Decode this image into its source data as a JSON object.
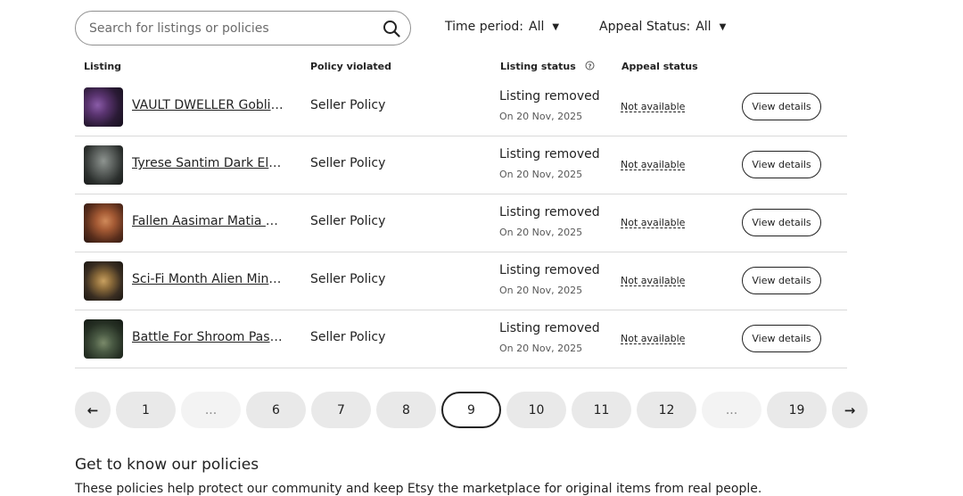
{
  "search": {
    "placeholder": "Search for listings or policies",
    "value": ""
  },
  "filters": {
    "time_period": {
      "label": "Time period:",
      "value": "All"
    },
    "appeal_status": {
      "label": "Appeal Status:",
      "value": "All"
    }
  },
  "columns": {
    "listing": "Listing",
    "policy": "Policy violated",
    "status": "Listing status",
    "appeal": "Appeal status"
  },
  "rows": [
    {
      "title": "VAULT DWELLER Goblin ...",
      "policy": "Seller Policy",
      "status": "Listing removed",
      "date": "On 20 Nov, 2025",
      "appeal": "Not available",
      "action": "View details"
    },
    {
      "title": "Tyrese Santim Dark Elf - ...",
      "policy": "Seller Policy",
      "status": "Listing removed",
      "date": "On 20 Nov, 2025",
      "appeal": "Not available",
      "action": "View details"
    },
    {
      "title": "Fallen Aasimar Matia Ka...",
      "policy": "Seller Policy",
      "status": "Listing removed",
      "date": "On 20 Nov, 2025",
      "appeal": "Not available",
      "action": "View details"
    },
    {
      "title": "Sci-Fi Month Alien Minia...",
      "policy": "Seller Policy",
      "status": "Listing removed",
      "date": "On 20 Nov, 2025",
      "appeal": "Not available",
      "action": "View details"
    },
    {
      "title": "Battle For Shroom Pass ...",
      "policy": "Seller Policy",
      "status": "Listing removed",
      "date": "On 20 Nov, 2025",
      "appeal": "Not available",
      "action": "View details"
    }
  ],
  "pagination": {
    "prev": "←",
    "pages": [
      "1",
      "...",
      "6",
      "7",
      "8",
      "9",
      "10",
      "11",
      "12",
      "...",
      "19"
    ],
    "current": "9",
    "next": "→"
  },
  "policies": {
    "heading": "Get to know our policies",
    "text": "These policies help protect our community and keep Etsy the marketplace for original items from real people."
  }
}
